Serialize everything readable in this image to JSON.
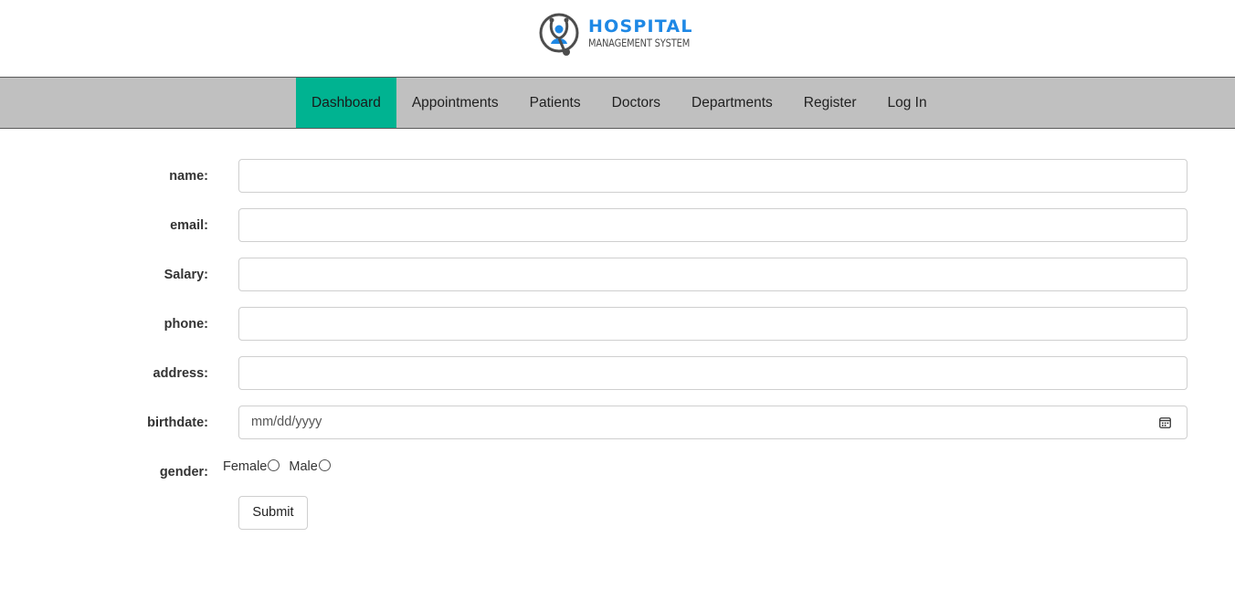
{
  "logo": {
    "title": "HOSPITAL",
    "subtitle": "MANAGEMENT SYSTEM",
    "icon": "stethoscope-icon",
    "accent_color": "#1e88e5"
  },
  "nav": {
    "active_color": "#00b391",
    "items": [
      {
        "label": "Dashboard",
        "active": true
      },
      {
        "label": "Appointments"
      },
      {
        "label": "Patients"
      },
      {
        "label": "Doctors"
      },
      {
        "label": "Departments"
      },
      {
        "label": "Register"
      },
      {
        "label": "Log In"
      }
    ]
  },
  "form": {
    "name_label": "name:",
    "email_label": "email:",
    "salary_label": "Salary:",
    "phone_label": "phone:",
    "address_label": "address:",
    "birthdate_label": "birthdate:",
    "birthdate_placeholder": "mm/dd/yyyy",
    "gender_label": "gender:",
    "gender_options": [
      "Female",
      "Male"
    ],
    "submit_label": "Submit"
  }
}
